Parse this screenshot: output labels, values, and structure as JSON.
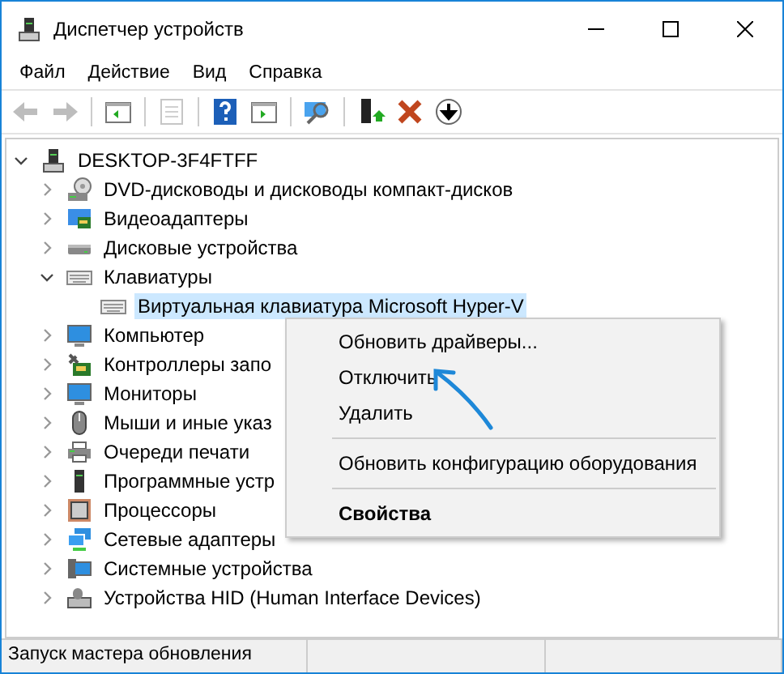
{
  "window": {
    "title": "Диспетчер устройств"
  },
  "menu": [
    "Файл",
    "Действие",
    "Вид",
    "Справка"
  ],
  "toolbar": [
    {
      "disabled": true
    },
    {
      "disabled": true
    },
    {
      "disabled": false
    },
    {
      "disabled": true
    },
    {
      "disabled": false
    },
    {
      "disabled": false
    },
    {
      "disabled": false
    },
    {
      "disabled": false
    },
    {
      "disabled": false
    },
    {
      "disabled": false
    }
  ],
  "tree": {
    "label": "DESKTOP-3F4FTFF",
    "expanded": true,
    "children": [
      {
        "label": "DVD-дисководы и дисководы компакт-дисков",
        "expanded": false,
        "selected": false
      },
      {
        "label": "Видеоадаптеры",
        "expanded": false,
        "selected": false
      },
      {
        "label": "Дисковые устройства",
        "expanded": false,
        "selected": false
      },
      {
        "label": "Клавиатуры",
        "expanded": true,
        "selected": false,
        "children": [
          {
            "label": "Виртуальная клавиатура Microsoft Hyper-V",
            "selected": true
          }
        ]
      },
      {
        "label": "Компьютер",
        "expanded": false,
        "selected": false
      },
      {
        "label": "Контроллеры запо",
        "expanded": false,
        "selected": false
      },
      {
        "label": "Мониторы",
        "expanded": false,
        "selected": false
      },
      {
        "label": "Мыши и иные указ",
        "expanded": false,
        "selected": false
      },
      {
        "label": "Очереди печати",
        "expanded": false,
        "selected": false
      },
      {
        "label": "Программные устр",
        "expanded": false,
        "selected": false
      },
      {
        "label": "Процессоры",
        "expanded": false,
        "selected": false
      },
      {
        "label": "Сетевые адаптеры",
        "expanded": false,
        "selected": false
      },
      {
        "label": "Системные устройства",
        "expanded": false,
        "selected": false
      },
      {
        "label": "Устройства HID (Human Interface Devices)",
        "expanded": false,
        "selected": false
      }
    ]
  },
  "context_menu": [
    {
      "label": "Обновить драйверы...",
      "kind": "item"
    },
    {
      "label": "Отключить",
      "kind": "item"
    },
    {
      "label": "Удалить",
      "kind": "item"
    },
    {
      "kind": "separator"
    },
    {
      "label": "Обновить конфигурацию оборудования",
      "kind": "item"
    },
    {
      "kind": "separator"
    },
    {
      "label": "Свойства",
      "kind": "default"
    }
  ],
  "status_bar": "Запуск мастера обновления"
}
